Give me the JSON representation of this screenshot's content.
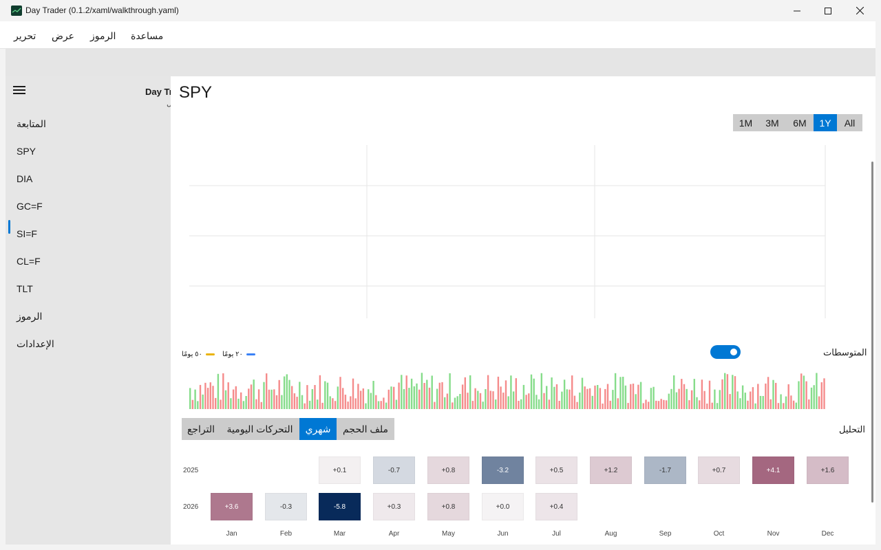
{
  "window": {
    "title": "Day Trader (0.1.2/xaml/walkthrough.yaml)"
  },
  "menu": {
    "items": [
      "تحرير",
      "عرض",
      "الرموز",
      "مساعدة"
    ]
  },
  "sidebar": {
    "peek_title": "Day Tr",
    "peek_sub": "ل",
    "items": [
      {
        "label": "المتابعة"
      },
      {
        "label": "SPY"
      },
      {
        "label": "DIA"
      },
      {
        "label": "GC=F"
      },
      {
        "label": "SI=F"
      },
      {
        "label": "CL=F"
      },
      {
        "label": "TLT"
      },
      {
        "label": "الرموز"
      },
      {
        "label": "الإعدادات"
      }
    ],
    "selected_index": 1
  },
  "main": {
    "symbol": "SPY",
    "ranges": [
      "1M",
      "3M",
      "6M",
      "1Y",
      "All"
    ],
    "active_range": "1Y",
    "averages_label": "المتوسطات",
    "averages_on": true,
    "legend": [
      {
        "label": "٢٠ يومًا",
        "color": "#3b82f6"
      },
      {
        "label": "٥٠ يومًا",
        "color": "#eab308"
      }
    ],
    "analysis_label": "التحليل",
    "tabs": [
      "ملف الحجم",
      "شهري",
      "التحركات اليومية",
      "التراجع"
    ],
    "active_tab": "شهري",
    "months": [
      "Jan",
      "Feb",
      "Mar",
      "Apr",
      "May",
      "Jun",
      "Jul",
      "Aug",
      "Sep",
      "Oct",
      "Nov",
      "Dec"
    ],
    "years": [
      {
        "year": "2025",
        "values": [
          null,
          null,
          "+0.1",
          "-0.7",
          "+0.8",
          "-3.2",
          "+0.5",
          "+1.2",
          "-1.7",
          "+0.7",
          "+4.1",
          "+1.6"
        ]
      },
      {
        "year": "2026",
        "values": [
          "+3.6",
          "-0.3",
          "-5.8",
          "+0.3",
          "+0.8",
          "+0.0",
          "+0.4",
          null,
          null,
          null,
          null,
          null
        ]
      }
    ]
  },
  "colors": {
    "accent": "#0078d4",
    "volume_up": "#86dc8a",
    "volume_down": "#f58b8b"
  }
}
